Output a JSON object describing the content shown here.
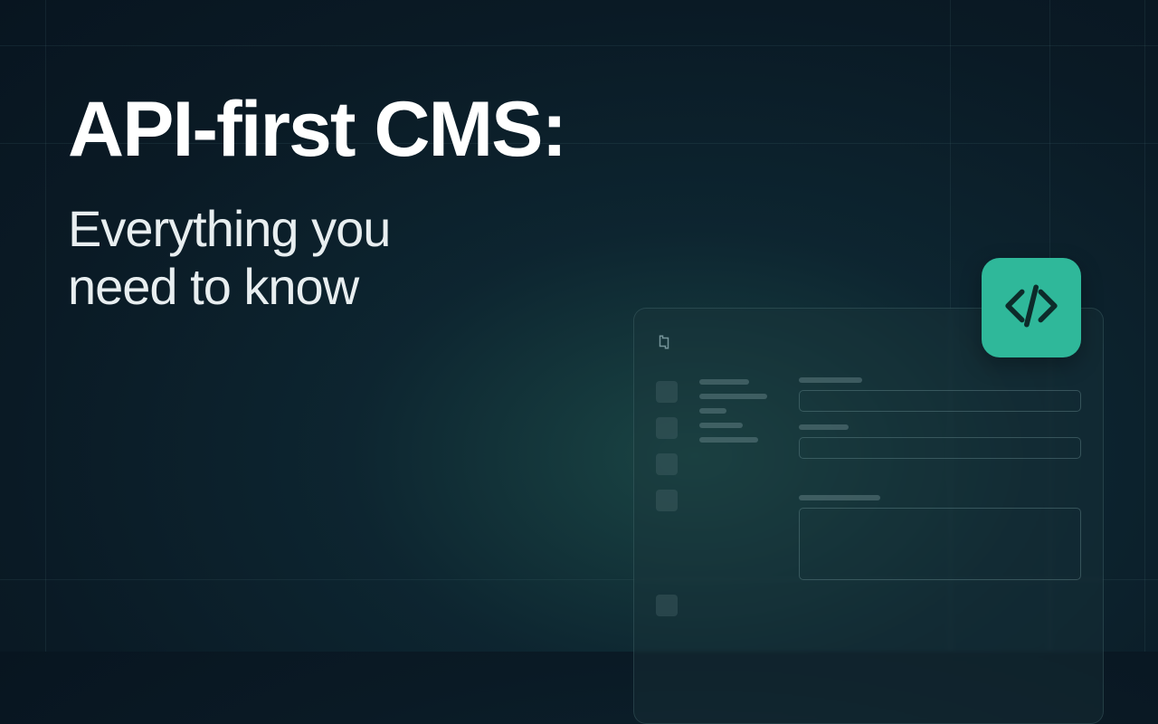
{
  "title": "API-first CMS:",
  "subtitle_line1": "Everything you",
  "subtitle_line2": "need to know",
  "colors": {
    "accent": "#2fb89a",
    "text_primary": "#ffffff",
    "text_secondary": "#e8eef0"
  },
  "icons": {
    "code": "code-icon",
    "logo": "logo-icon"
  }
}
